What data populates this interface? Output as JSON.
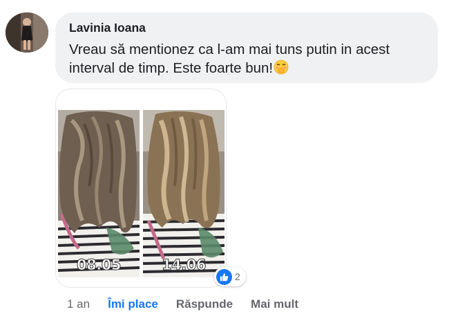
{
  "comment": {
    "author": "Lavinia Ioana",
    "text": "Vreau să mentionez ca l-am mai tuns putin in acest interval de timp. Este foarte bun!",
    "emoji_icon": "face-with-hand-over-mouth-emoji"
  },
  "photos": [
    {
      "date_label": "08.05"
    },
    {
      "date_label": "14.06"
    }
  ],
  "reactions": {
    "icon": "like-icon",
    "count": "2"
  },
  "actions": {
    "timestamp": "1 an",
    "like_label": "Îmi place",
    "reply_label": "Răspunde",
    "more_label": "Mai mult"
  },
  "colors": {
    "bubble": "#eff1f3",
    "accent": "#1877f2",
    "meta": "#65676b"
  }
}
